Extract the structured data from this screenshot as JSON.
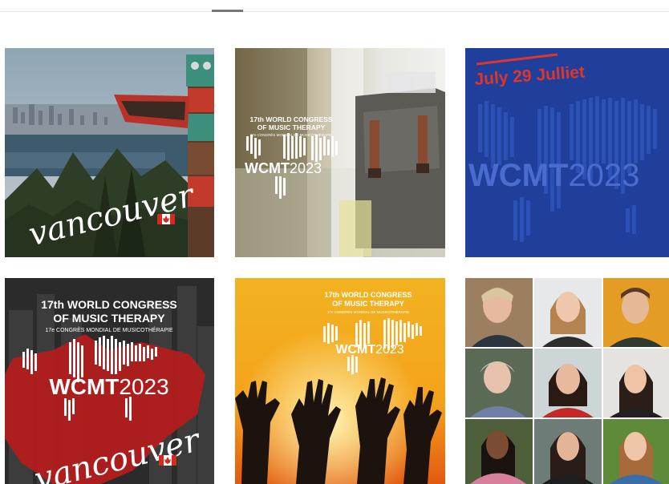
{
  "grid": {
    "tile1": {
      "script": "vancouver"
    },
    "tile2": {
      "congress_lines": [
        "17th WORLD CONGRESS",
        "OF MUSIC THERAPY"
      ],
      "subtitle": "17e CONGRÈS MONDIAL DE MUSICOTHÉRAPIE",
      "brand_left": "WCMT",
      "brand_right": "2023"
    },
    "tile3": {
      "date": "July 29 Julliet",
      "brand_left": "WCMT",
      "brand_right": "2023"
    },
    "tile4": {
      "congress_lines": [
        "17th WORLD CONGRESS",
        "OF MUSIC THERAPY"
      ],
      "subtitle": "17e CONGRÈS MONDIAL DE MUSICOTHÉRAPIE",
      "brand_left": "WCMT",
      "brand_right": "2023",
      "script": "vancouver"
    },
    "tile5": {
      "congress_lines": [
        "17th WORLD CONGRESS",
        "OF MUSIC THERAPY"
      ],
      "subtitle": "17e CONGRÈS MONDIAL DE MUSICOTHÉRAPIE",
      "brand_left": "WCMT",
      "brand_right": "2023"
    }
  },
  "colors": {
    "blue_panel": "#1f3f9b",
    "red_accent": "#e0352b",
    "sunset_top": "#f2b320",
    "sunset_bottom": "#e25a0f",
    "maple_red": "#b71c1c"
  }
}
